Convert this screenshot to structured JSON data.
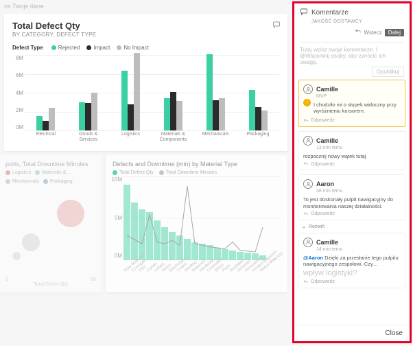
{
  "dashboard": {
    "top_strip": "ns Twoje dane"
  },
  "panel": {
    "title": "Komentarze",
    "subtitle": "JAKOŚĆ DOSTAWCY",
    "back_label": "Wstecz",
    "next_label": "Dalej",
    "compose_placeholder": "Tutaj wpisz swoje komentarze. I @Wspomnij osoby, aby zwrócić ich uwagę.",
    "post_label": "Opublikuj",
    "expand_label": "Rozwiń",
    "reply_label": "Odpowiedz",
    "close_label": "Close",
    "big_question": "wpływ logistyki?"
  },
  "comments": [
    {
      "user": "Camille",
      "time": "MVP",
      "body": "I chodziło mi o słupek widoczny przy wyróżnieniu kursorem.",
      "selected": true,
      "badge": true
    },
    {
      "user": "Camille",
      "time": "13 min temu",
      "body": "rozpocznij nowy wątek tutaj"
    },
    {
      "user": "Aaron",
      "time": "38 min temu",
      "body": "To jest doskonały pulpit nawigacyjny do monitorowania naszej działalności.",
      "expand_after": true
    },
    {
      "user": "Camille",
      "time": "14 min temu",
      "mention": "@Aaron",
      "body": "Dzięki za przesłanie tego pulpitu nawigacyjnego zespołowi. Czy…"
    }
  ],
  "chart_data": [
    {
      "id": "defect_qty",
      "type": "bar",
      "title": "Total Defect Qty",
      "subtitle": "BY CATEGORY, DEFECT TYPE",
      "legend_title": "Defect Type",
      "series_names": [
        "Rejected",
        "Impact",
        "No Impact"
      ],
      "series_colors": [
        "#3AD0A3",
        "#2b2b2b",
        "#bdbdbd"
      ],
      "categories": [
        "Electrical",
        "Goods & Services",
        "Logistics",
        "Materials & Components",
        "Mechanicals",
        "Packaging"
      ],
      "series": [
        {
          "name": "Rejected",
          "values": [
            1.5,
            3.0,
            6.3,
            3.4,
            8.1,
            4.3
          ]
        },
        {
          "name": "Impact",
          "values": [
            1.0,
            2.9,
            2.8,
            4.1,
            3.2,
            2.5
          ]
        },
        {
          "name": "No Impact",
          "values": [
            2.4,
            4.0,
            8.2,
            3.1,
            3.4,
            2.1
          ]
        }
      ],
      "ylabel": "",
      "ylim": [
        0,
        8
      ],
      "yticks": [
        "0M",
        "2M",
        "4M",
        "6M",
        "8M"
      ]
    },
    {
      "id": "scatter_downtime",
      "type": "scatter",
      "title": "ports, Total Downtime Minutes",
      "legend": [
        "Logistics",
        "Materials &…",
        "Mechanicals",
        "Packaging"
      ],
      "legend_colors": [
        "#e08080",
        "#9fd0b8",
        "#bdbdbd",
        "#7faed4"
      ],
      "xlabel": "Total Defect Qty",
      "ylim": [
        0,
        50
      ],
      "yticks": [
        "0",
        "50"
      ],
      "points": [
        {
          "x": 0.72,
          "y": 0.3,
          "r": 20,
          "color": "#e08080"
        },
        {
          "x": 0.28,
          "y": 0.62,
          "r": 13,
          "color": "#bdbdbd"
        },
        {
          "x": 0.12,
          "y": 0.78,
          "r": 6,
          "color": "#bdbdbd"
        }
      ]
    },
    {
      "id": "defects_downtime_material",
      "type": "bar",
      "title": "Defects and Downtime (min) by Material Type",
      "legend": [
        "Total Defect Qty",
        "Total Downtime Minutes"
      ],
      "legend_colors": [
        "#3AD0A3",
        "#bdbdbd"
      ],
      "categories": [
        "Raw Materials",
        "Corrugate",
        "Film",
        "Carton",
        "Labels",
        "Glass",
        "Electrolytes",
        "Crates",
        "Molding",
        "Batteries",
        "Hardware",
        "Controllers",
        "Wires",
        "Parts",
        "Insulation",
        "Solvents",
        "Accessories",
        "Printed Materials",
        "Mixed Materials"
      ],
      "values": [
        92,
        70,
        62,
        58,
        48,
        40,
        34,
        30,
        26,
        22,
        20,
        18,
        15,
        13,
        12,
        10,
        9,
        8,
        6
      ],
      "line_values": [
        30,
        25,
        20,
        55,
        22,
        20,
        24,
        18,
        90,
        20,
        18,
        16,
        15,
        14,
        22,
        12,
        11,
        10,
        40
      ],
      "ylim": [
        0,
        100
      ],
      "yticks": [
        "0M",
        "5M",
        "10M"
      ]
    }
  ]
}
